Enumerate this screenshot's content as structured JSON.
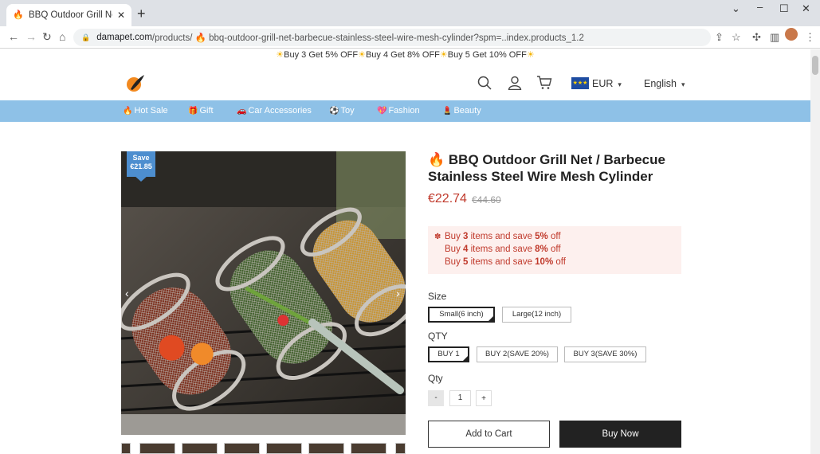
{
  "browser": {
    "tab_title": "BBQ Outdoor Grill Net / Barbe",
    "tab_favicon": "🔥",
    "url_domain": "damapet.com",
    "url_path": "/products/ 🔥 bbq-outdoor-grill-net-barbecue-stainless-steel-wire-mesh-cylinder?spm=..index.products_1.2",
    "new_tab": "+",
    "close": "✕"
  },
  "promo": {
    "sun": "☀",
    "parts": [
      "Buy 3 Get 5% OFF",
      "Buy 4 Get 8% OFF",
      "Buy 5 Get 10% OFF"
    ]
  },
  "header": {
    "currency": "EUR",
    "language": "English",
    "flag_stars": "★★★"
  },
  "nav": {
    "items": [
      {
        "icon": "🔥",
        "label": "Hot Sale"
      },
      {
        "icon": "🎁",
        "label": "Gift"
      },
      {
        "icon": "🚗",
        "label": "Car Accessories"
      },
      {
        "icon": "⚽",
        "label": "Toy"
      },
      {
        "icon": "💖",
        "label": "Fashion"
      },
      {
        "icon": "💄",
        "label": "Beauty"
      }
    ]
  },
  "product": {
    "save_label": "Save",
    "save_amount": "€21.85",
    "title_icon": "🔥",
    "title": "BBQ Outdoor Grill Net / Barbecue Stainless Steel Wire Mesh Cylinder",
    "price": "€22.74",
    "old_price": "€44.60",
    "discounts": [
      {
        "pre": "Buy ",
        "qty": "3",
        "mid": " items and save ",
        "pct": "5%",
        "post": " off"
      },
      {
        "pre": "Buy ",
        "qty": "4",
        "mid": " items and save ",
        "pct": "8%",
        "post": " off"
      },
      {
        "pre": "Buy ",
        "qty": "5",
        "mid": " items and save ",
        "pct": "10%",
        "post": " off"
      }
    ],
    "size_label": "Size",
    "sizes": [
      "Small(6 inch)",
      "Large(12 inch)"
    ],
    "qty_option_label": "QTY",
    "qty_options": [
      "BUY 1",
      "BUY 2(SAVE 20%)",
      "BUY 3(SAVE 30%)"
    ],
    "qty_label": "Qty",
    "qty_minus": "-",
    "qty_value": "1",
    "qty_plus": "+",
    "add_to_cart": "Add to Cart",
    "buy_now": "Buy Now"
  },
  "colors": {
    "nav_bg": "#8ec1e7",
    "price": "#c0392b",
    "badge": "#4d8ecf"
  }
}
